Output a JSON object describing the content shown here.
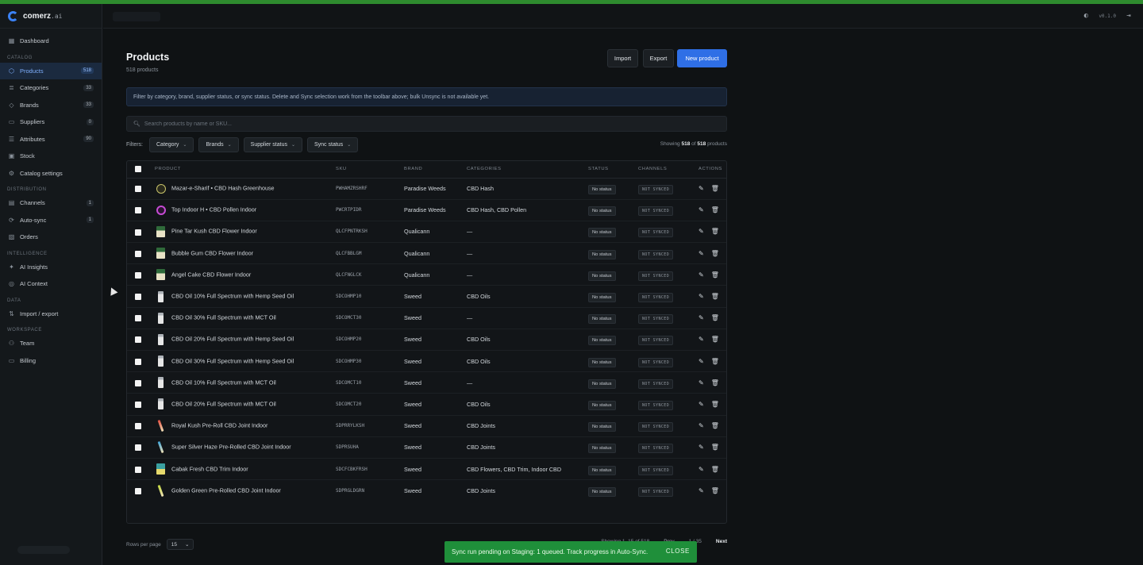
{
  "app": {
    "name": "comerz",
    "name_suffix": ".ai",
    "version": "v0.1.0"
  },
  "sidebar": {
    "top": {
      "label": "Dashboard",
      "icon": "dashboard-icon"
    },
    "sections": [
      {
        "label": "CATALOG",
        "items": [
          {
            "label": "Products",
            "count": "518",
            "icon": "box-icon",
            "active": true
          },
          {
            "label": "Categories",
            "count": "33",
            "icon": "layers-icon"
          },
          {
            "label": "Brands",
            "count": "33",
            "icon": "tag-icon"
          },
          {
            "label": "Suppliers",
            "count": "0",
            "icon": "truck-icon"
          },
          {
            "label": "Attributes",
            "count": "90",
            "icon": "list-icon"
          },
          {
            "label": "Stock",
            "count": "",
            "icon": "package-icon"
          },
          {
            "label": "Catalog settings",
            "count": "",
            "icon": "gear-icon"
          }
        ]
      },
      {
        "label": "DISTRIBUTION",
        "items": [
          {
            "label": "Channels",
            "count": "1",
            "icon": "channels-icon"
          },
          {
            "label": "Auto-sync",
            "count": "1",
            "icon": "sync-icon"
          },
          {
            "label": "Orders",
            "count": "",
            "icon": "orders-icon"
          }
        ]
      },
      {
        "label": "INTELLIGENCE",
        "items": [
          {
            "label": "AI Insights",
            "count": "",
            "icon": "sparkle-icon"
          },
          {
            "label": "AI Context",
            "count": "",
            "icon": "context-icon"
          }
        ]
      },
      {
        "label": "DATA",
        "items": [
          {
            "label": "Import / export",
            "count": "",
            "icon": "transfer-icon"
          }
        ]
      },
      {
        "label": "WORKSPACE",
        "items": [
          {
            "label": "Team",
            "count": "",
            "icon": "team-icon"
          },
          {
            "label": "Billing",
            "count": "",
            "icon": "billing-icon"
          }
        ]
      }
    ]
  },
  "page": {
    "title": "Products",
    "subtitle": "518 products",
    "buttons": {
      "import": "Import",
      "export": "Export",
      "new": "New product"
    },
    "info": "Filter by category, brand, supplier status, or sync status. Delete and Sync selection work from the toolbar above; bulk Unsync is not available yet.",
    "search_placeholder": "Search products by name or SKU...",
    "filters_label": "Filters:",
    "filters": [
      "Category",
      "Brands",
      "Supplier status",
      "Sync status"
    ],
    "showing_prefix": "Showing",
    "showing_count": "518",
    "showing_of": "of",
    "showing_total": "518",
    "showing_suffix": "products"
  },
  "table": {
    "headers": [
      "PRODUCT",
      "SKU",
      "BRAND",
      "CATEGORIES",
      "STATUS",
      "CHANNELS",
      "ACTIONS"
    ],
    "rows": [
      {
        "name": "Mazar-e-Sharif • CBD Hash Greenhouse",
        "sku": "PWHAMZRSHRF",
        "brand": "Paradise Weeds",
        "categories": "CBD Hash",
        "status": "No status",
        "channels": "NOT SYNCED",
        "thumb": "circle"
      },
      {
        "name": "Top Indoor H • CBD Pollen Indoor",
        "sku": "PWCRTPIDR",
        "brand": "Paradise Weeds",
        "categories": "CBD Hash, CBD Pollen",
        "status": "No status",
        "channels": "NOT SYNCED",
        "thumb": "pink"
      },
      {
        "name": "Pine Tar Kush CBD Flower Indoor",
        "sku": "QLCFPNTRKSH",
        "brand": "Qualicann",
        "categories": "—",
        "status": "No status",
        "channels": "NOT SYNCED",
        "thumb": "flower"
      },
      {
        "name": "Bubble Gum CBD Flower Indoor",
        "sku": "QLCFBBLGM",
        "brand": "Qualicann",
        "categories": "—",
        "status": "No status",
        "channels": "NOT SYNCED",
        "thumb": "flower"
      },
      {
        "name": "Angel Cake CBD Flower Indoor",
        "sku": "QLCFNGLCK",
        "brand": "Qualicann",
        "categories": "—",
        "status": "No status",
        "channels": "NOT SYNCED",
        "thumb": "flower"
      },
      {
        "name": "CBD Oil 10% Full Spectrum with Hemp Seed Oil",
        "sku": "SDCOHMP10",
        "brand": "Sweed",
        "categories": "CBD Oils",
        "status": "No status",
        "channels": "NOT SYNCED",
        "thumb": "bottle"
      },
      {
        "name": "CBD Oil 30% Full Spectrum with MCT Oil",
        "sku": "SDCOMCT30",
        "brand": "Sweed",
        "categories": "—",
        "status": "No status",
        "channels": "NOT SYNCED",
        "thumb": "bottle"
      },
      {
        "name": "CBD Oil 20% Full Spectrum with Hemp Seed Oil",
        "sku": "SDCOHMP20",
        "brand": "Sweed",
        "categories": "CBD Oils",
        "status": "No status",
        "channels": "NOT SYNCED",
        "thumb": "bottle"
      },
      {
        "name": "CBD Oil 30% Full Spectrum with Hemp Seed Oil",
        "sku": "SDCOHMP30",
        "brand": "Sweed",
        "categories": "CBD Oils",
        "status": "No status",
        "channels": "NOT SYNCED",
        "thumb": "bottle"
      },
      {
        "name": "CBD Oil 10% Full Spectrum with MCT Oil",
        "sku": "SDCOMCT10",
        "brand": "Sweed",
        "categories": "—",
        "status": "No status",
        "channels": "NOT SYNCED",
        "thumb": "bottle"
      },
      {
        "name": "CBD Oil 20% Full Spectrum with MCT Oil",
        "sku": "SDCOMCT20",
        "brand": "Sweed",
        "categories": "CBD Oils",
        "status": "No status",
        "channels": "NOT SYNCED",
        "thumb": "bottle"
      },
      {
        "name": "Royal Kush Pre-Roll CBD Joint Indoor",
        "sku": "SDPRRYLKSH",
        "brand": "Sweed",
        "categories": "CBD Joints",
        "status": "No status",
        "channels": "NOT SYNCED",
        "thumb": "joint"
      },
      {
        "name": "Super Silver Haze Pre-Rolled CBD Joint Indoor",
        "sku": "SDPRSUHA",
        "brand": "Sweed",
        "categories": "CBD Joints",
        "status": "No status",
        "channels": "NOT SYNCED",
        "thumb": "joint2"
      },
      {
        "name": "Cabak Fresh CBD Trim Indoor",
        "sku": "SDCFCBKFRSH",
        "brand": "Sweed",
        "categories": "CBD Flowers, CBD Trim, Indoor CBD",
        "status": "No status",
        "channels": "NOT SYNCED",
        "thumb": "trim"
      },
      {
        "name": "Golden Green Pre-Rolled CBD Joint Indoor",
        "sku": "SDPRGLDGRN",
        "brand": "Sweed",
        "categories": "CBD Joints",
        "status": "No status",
        "channels": "NOT SYNCED",
        "thumb": "joint3"
      }
    ]
  },
  "footer": {
    "rows_per_page_label": "Rows per page",
    "rows_per_page": "15",
    "showing_range": "Showing 1–15 of 518",
    "prev": "Prev",
    "page": "1 / 35",
    "next": "Next"
  },
  "toast": {
    "message": "Sync run pending on Staging: 1 queued. Track progress in Auto-Sync.",
    "close": "CLOSE"
  },
  "colors": {
    "accent": "#2f6fe6",
    "toast": "#1f8f3a"
  }
}
